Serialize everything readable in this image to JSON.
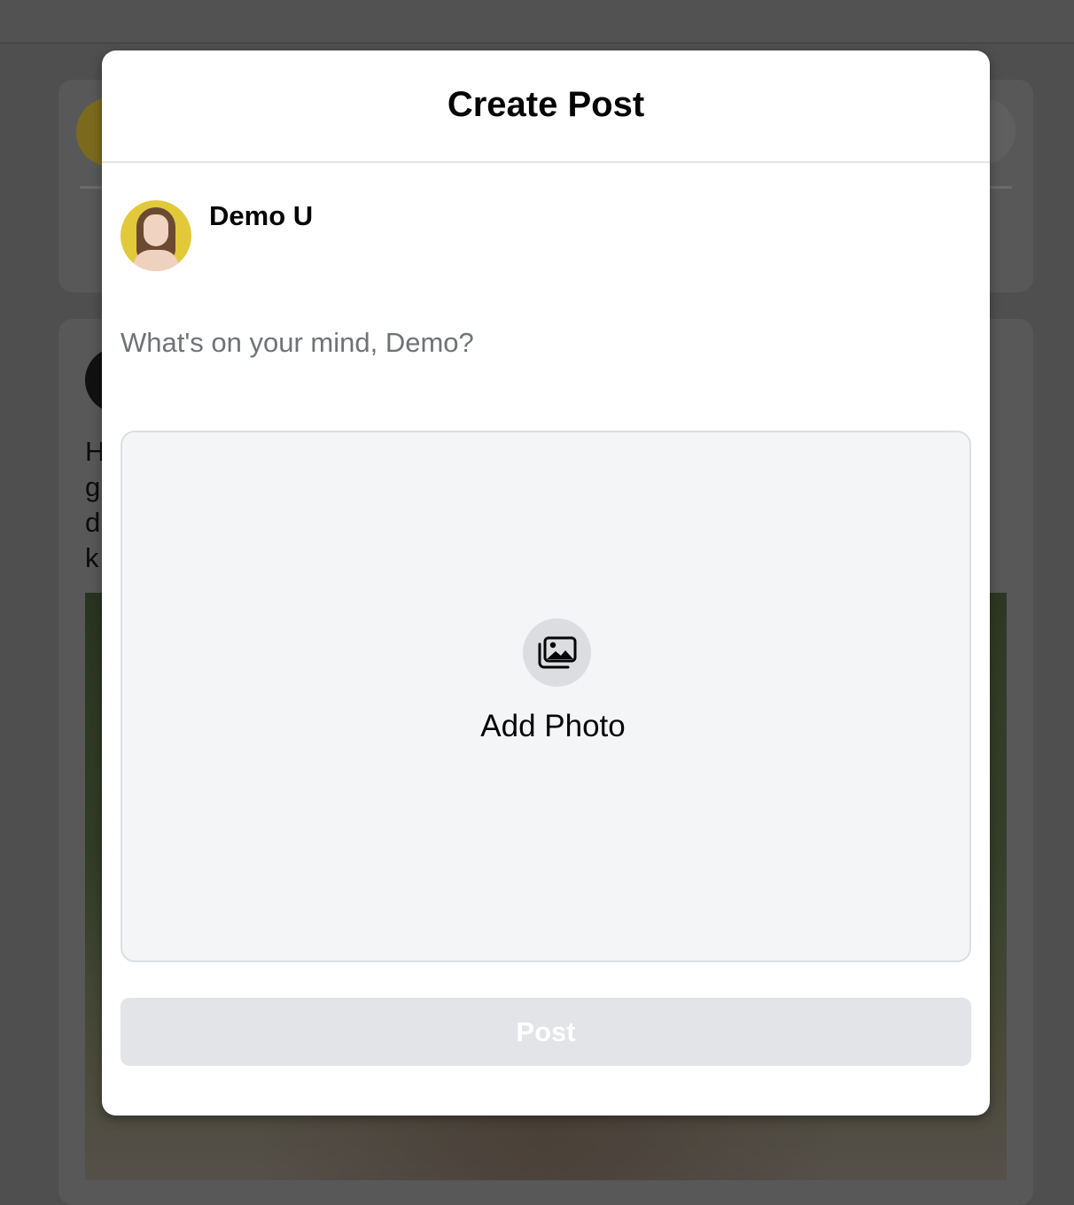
{
  "background": {
    "feed_text_lines": [
      "H",
      "g",
      "d",
      "k"
    ]
  },
  "modal": {
    "title": "Create Post",
    "author": {
      "name": "Demo U",
      "avatar_icon": "user-avatar"
    },
    "composer": {
      "placeholder": "What's on your mind, Demo?",
      "value": ""
    },
    "add_photo": {
      "icon": "photo-gallery-icon",
      "label": "Add Photo"
    },
    "post_button": {
      "label": "Post",
      "enabled": false
    }
  },
  "colors": {
    "overlay": "#4f4f4f",
    "modal_bg": "#ffffff",
    "dropzone_bg": "#f4f5f7",
    "disabled_button_bg": "#e3e4e7",
    "placeholder_text": "#6f7277"
  }
}
